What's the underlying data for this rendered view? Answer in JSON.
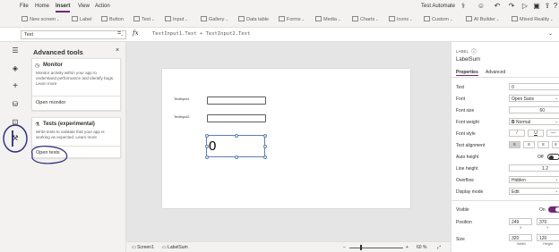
{
  "menu": [
    "File",
    "Home",
    "Insert",
    "View",
    "Action"
  ],
  "menu_active": "Insert",
  "app_name": "Test Automate",
  "top_icons": [
    "stethoscope-icon",
    "person-icon",
    "undo-icon",
    "redo-icon",
    "play-icon",
    "save-icon",
    "publish-icon",
    "help-icon"
  ],
  "ribbon": [
    {
      "label": "New screen",
      "dropdown": true
    },
    {
      "label": "Label",
      "dropdown": false
    },
    {
      "label": "Button",
      "dropdown": false
    },
    {
      "label": "Text",
      "dropdown": true
    },
    {
      "label": "Input",
      "dropdown": true
    },
    {
      "label": "Gallery",
      "dropdown": true
    },
    {
      "label": "Data table",
      "dropdown": false
    },
    {
      "label": "Forms",
      "dropdown": true
    },
    {
      "label": "Media",
      "dropdown": true
    },
    {
      "label": "Charts",
      "dropdown": true
    },
    {
      "label": "Icons",
      "dropdown": true
    },
    {
      "label": "Custom",
      "dropdown": true
    },
    {
      "label": "AI Builder",
      "dropdown": true
    },
    {
      "label": "Mixed Reality",
      "dropdown": true
    }
  ],
  "formula_bar": {
    "property": "Text",
    "equals": "=",
    "fx": "fx",
    "formula": "TextInput1.Text + TextInput2.Text"
  },
  "panel": {
    "title": "Advanced tools",
    "close": "×",
    "cards": [
      {
        "title": "Monitor",
        "description": "Monitor activity within your app to understand performance and identify bugs. Learn more",
        "link": "Open monitor"
      },
      {
        "title": "Tests (experimental)",
        "description": "Write tests to validate that your app is working as expected. Learn more",
        "link": "Open tests"
      }
    ]
  },
  "canvas": {
    "label1": "TextInput1",
    "label2": "TextInput2",
    "sum_value": "0"
  },
  "status": {
    "screen": "Screen1",
    "control": "LabelSum",
    "minus": "−",
    "plus": "+",
    "zoom": "60 %"
  },
  "props": {
    "type": "LABEL",
    "name": "LabelSum",
    "tabs": [
      "Properties",
      "Advanced"
    ],
    "active_tab": "Properties",
    "rows": {
      "text_label": "Text",
      "text_value": "0",
      "font_label": "Font",
      "font_value": "Open Sans",
      "font_size_label": "Font size",
      "font_size_value": "60",
      "font_weight_label": "Font weight",
      "font_weight_value": "Normal",
      "font_style_label": "Font style",
      "italic": "/",
      "underline": "U",
      "strike": "—",
      "text_align_label": "Text alignment",
      "auto_height_label": "Auto height",
      "auto_height_value": "Off",
      "line_height_label": "Line height",
      "line_height_value": "1.2",
      "overflow_label": "Overflow",
      "overflow_value": "Hidden",
      "display_mode_label": "Display mode",
      "display_mode_value": "Edit",
      "visible_label": "Visible",
      "visible_value": "On",
      "position_label": "Position",
      "pos_x": "249",
      "pos_y": "370",
      "pos_x_cap": "X",
      "pos_y_cap": "Y",
      "size_label": "Size",
      "width": "320",
      "height": "120",
      "width_cap": "Width",
      "height_cap": "Height"
    }
  },
  "colors": {
    "accent": "#742774",
    "annotation": "#2b2a7a"
  }
}
